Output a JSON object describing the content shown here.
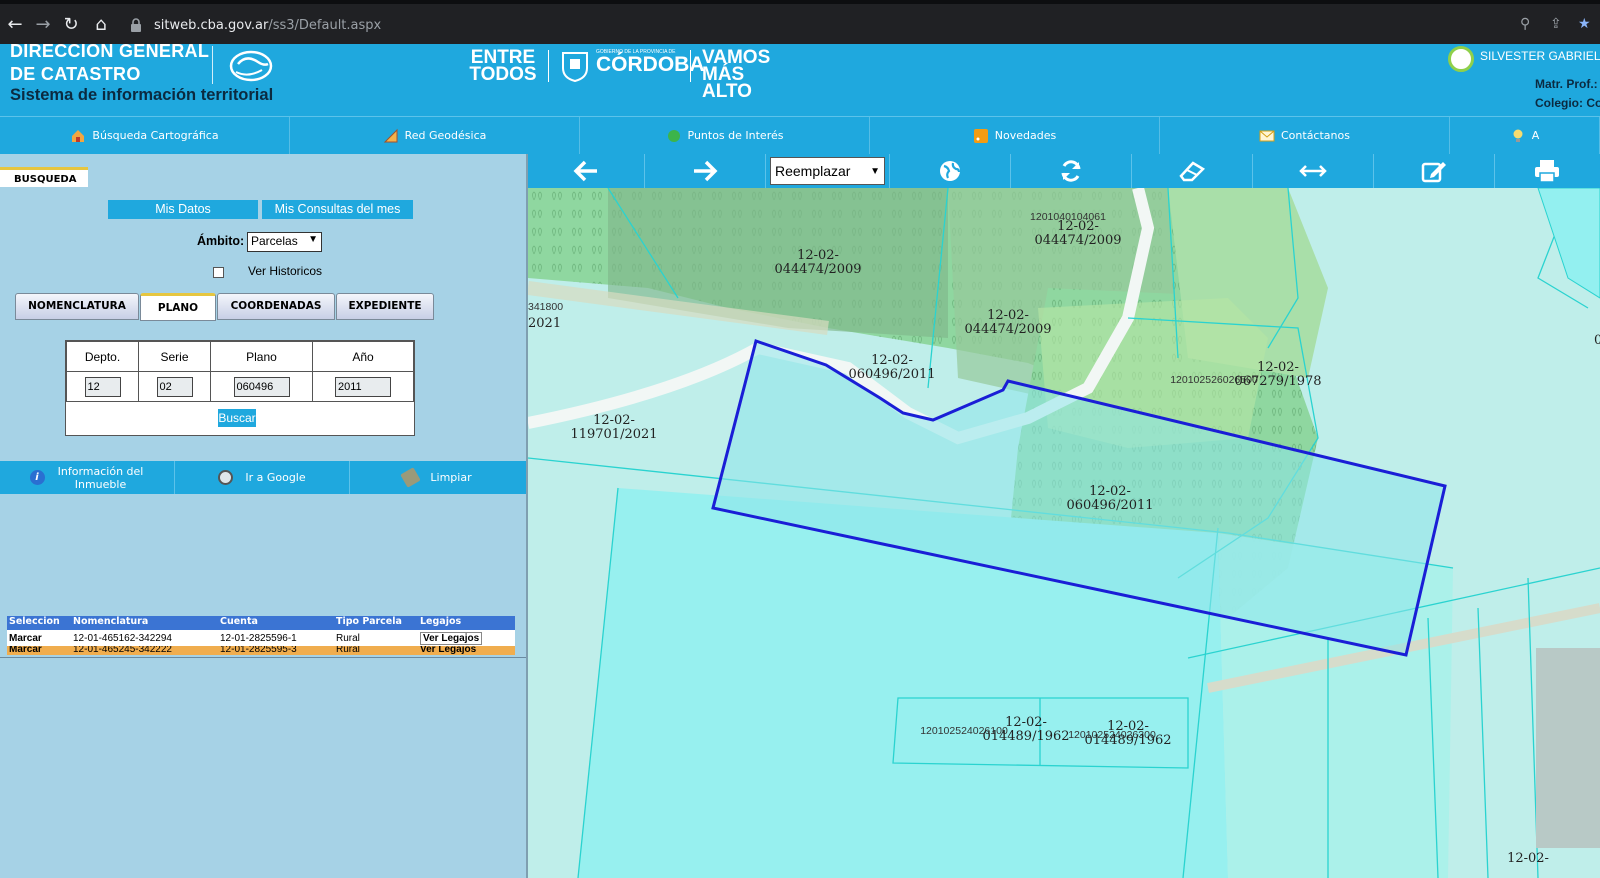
{
  "browser": {
    "url_host": "sitweb.cba.gov.ar",
    "url_path": "/ss3/Default.aspx"
  },
  "header": {
    "title_line1": "DIRECCION GENERAL",
    "title_line2": "DE CATASTRO",
    "subtitle": "Sistema de información territorial",
    "brand_left": "ENTRE TODOS",
    "brand_center_small": "GOBIERNO DE LA PROVINCIA DE",
    "brand_center": "CÓRDOBA",
    "brand_right": "VAMOS MÁS ALTO",
    "user_name": "SILVESTER GABRIEL GU",
    "matr_label": "Matr. Prof.:",
    "colegio_label": "Colegio: Co"
  },
  "nav": [
    {
      "label": "Búsqueda Cartográfica",
      "icon": "home-icon"
    },
    {
      "label": "Red Geodésica",
      "icon": "ruler-icon"
    },
    {
      "label": "Puntos de Interés",
      "icon": "green-dot-icon"
    },
    {
      "label": "Novedades",
      "icon": "rss-icon"
    },
    {
      "label": "Contáctanos",
      "icon": "envelope-icon"
    },
    {
      "label": "A",
      "icon": "lightbulb-icon"
    }
  ],
  "left": {
    "tab": "BUSQUEDA",
    "mis_datos": "Mis Datos",
    "mis_consultas": "Mis Consultas del mes",
    "ambito_label": "Ámbito:",
    "ambito_value": "Parcelas",
    "ver_historicos": "Ver Historicos",
    "subtabs": [
      "NOMENCLATURA",
      "PLANO",
      "COORDENADAS",
      "EXPEDIENTE"
    ],
    "form": {
      "headers": [
        "Depto.",
        "Serie",
        "Plano",
        "Año"
      ],
      "values": [
        "12",
        "02",
        "060496",
        "2011"
      ],
      "buscar": "Buscar"
    },
    "actions": [
      "Información del Inmueble",
      "Ir a Google",
      "Limpiar"
    ],
    "results": {
      "headers": [
        "Seleccion",
        "Nomenclatura",
        "Cuenta",
        "Tipo Parcela",
        "Legajos"
      ],
      "rows": [
        [
          "Marcar",
          "12-01-465162-342294",
          "12-01-2825596-1",
          "Rural",
          "Ver Legajos"
        ],
        [
          "Marcar",
          "12-01-465245-342222",
          "12-01-2825595-3",
          "Rural",
          "Ver Legajos"
        ]
      ]
    }
  },
  "toolbar": {
    "mode_select": "Reemplazar",
    "icons": [
      "arrow-left-icon",
      "arrow-right-icon",
      "globe-icon",
      "refresh-icon",
      "eraser-icon",
      "measure-icon",
      "edit-icon",
      "print-icon"
    ]
  },
  "map": {
    "labels": [
      "12-02-",
      "044474/2009",
      "1201040104061",
      "12-02-",
      "044474/2009",
      "12-02-",
      "044474/2009",
      "341800",
      "2021",
      "12-02-",
      "060496/2011",
      "12-02-",
      "119701/2021",
      "120102526026500",
      "12-02-",
      "067279/1978",
      "12-02-",
      "060496/2011",
      "120102524026100",
      "12-02-",
      "014489/1962",
      "120102524026300",
      "12-02-",
      "014489/1962",
      "12-02-",
      "0"
    ]
  },
  "colors": {
    "header_blue": "#1fa8de",
    "left_panel": "#a6d2e6",
    "selected_parcel_stroke": "#1a1ed6"
  }
}
